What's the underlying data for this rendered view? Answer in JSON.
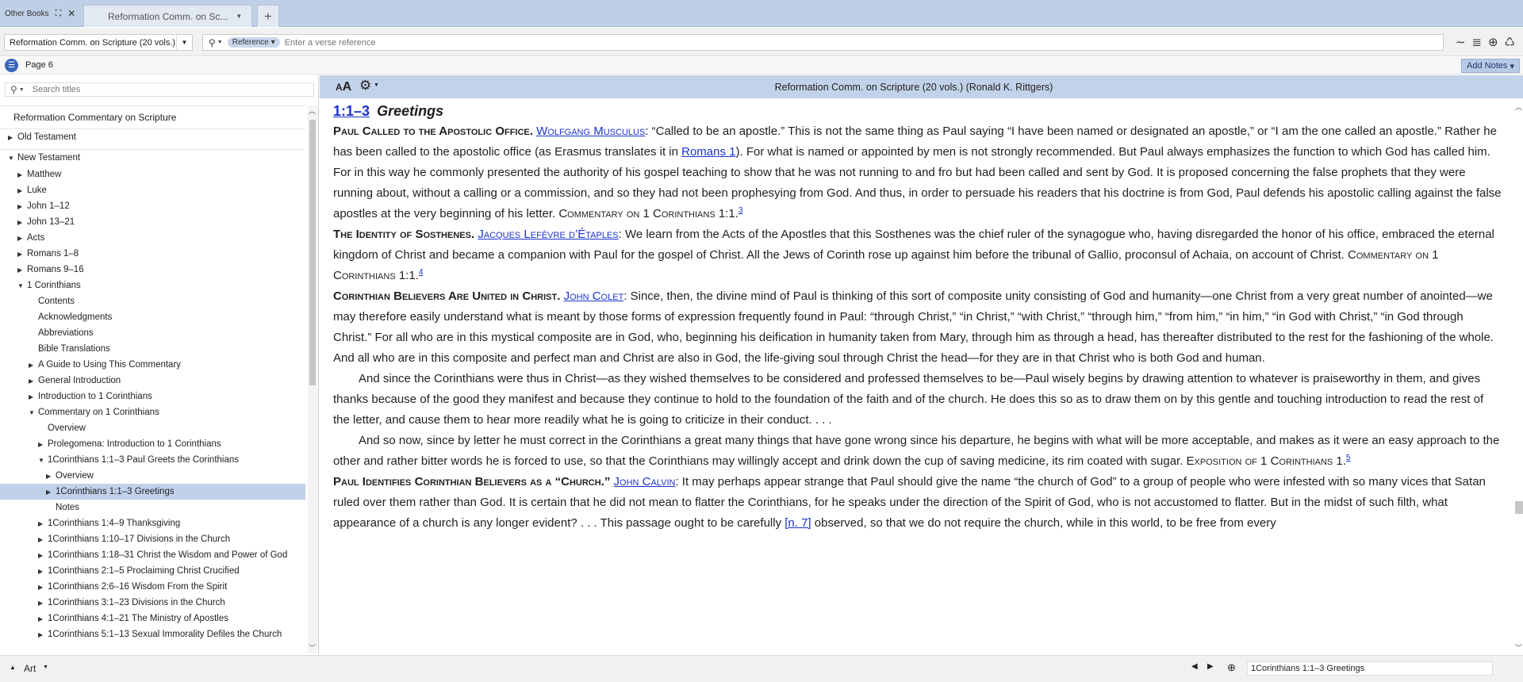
{
  "tabs": {
    "other_books": "Other Books",
    "active": "Reformation Comm. on Sc...",
    "add": "+"
  },
  "toolbar": {
    "resource": "Reformation Comm. on Scripture (20 vols.)",
    "ref_pill": "Reference",
    "ref_placeholder": "Enter a verse reference"
  },
  "pagebar": {
    "page": "Page 6",
    "add_notes": "Add Notes"
  },
  "sidebar": {
    "search_placeholder": "Search titles",
    "root": "Reformation Commentary on Scripture",
    "items": [
      {
        "label": "Old Testament",
        "arrow": "▶"
      },
      {
        "label": "New Testament",
        "arrow": "▼"
      },
      {
        "label": "Matthew",
        "arrow": "▶"
      },
      {
        "label": "Luke",
        "arrow": "▶"
      },
      {
        "label": "John 1–12",
        "arrow": "▶"
      },
      {
        "label": "John 13–21",
        "arrow": "▶"
      },
      {
        "label": "Acts",
        "arrow": "▶"
      },
      {
        "label": "Romans 1–8",
        "arrow": "▶"
      },
      {
        "label": "Romans 9–16",
        "arrow": "▶"
      },
      {
        "label": "1 Corinthians",
        "arrow": "▼"
      },
      {
        "label": "Contents",
        "arrow": ""
      },
      {
        "label": "Acknowledgments",
        "arrow": ""
      },
      {
        "label": "Abbreviations",
        "arrow": ""
      },
      {
        "label": "Bible Translations",
        "arrow": ""
      },
      {
        "label": "A Guide to Using This Commentary",
        "arrow": "▶"
      },
      {
        "label": "General Introduction",
        "arrow": "▶"
      },
      {
        "label": "Introduction to 1 Corinthians",
        "arrow": "▶"
      },
      {
        "label": "Commentary on 1 Corinthians",
        "arrow": "▼"
      },
      {
        "label": "Overview",
        "arrow": ""
      },
      {
        "label": "Prolegomena: Introduction to 1 Corinthians",
        "arrow": "▶"
      },
      {
        "label": "1Corinthians 1:1–3 Paul Greets the Corinthians",
        "arrow": "▼"
      },
      {
        "label": "Overview",
        "arrow": "▶"
      },
      {
        "label": "1Corinthians 1:1–3 Greetings",
        "arrow": "▶"
      },
      {
        "label": "Notes",
        "arrow": ""
      },
      {
        "label": "1Corinthians 1:4–9 Thanksgiving",
        "arrow": "▶"
      },
      {
        "label": "1Corinthians 1:10–17 Divisions in the Church",
        "arrow": "▶"
      },
      {
        "label": "1Corinthians 1:18–31 Christ the Wisdom and Power of God",
        "arrow": "▶"
      },
      {
        "label": "1Corinthians 2:1–5 Proclaiming Christ Crucified",
        "arrow": "▶"
      },
      {
        "label": "1Corinthians 2:6–16 Wisdom From the Spirit",
        "arrow": "▶"
      },
      {
        "label": "1Corinthians 3:1–23 Divisions in the Church",
        "arrow": "▶"
      },
      {
        "label": "1Corinthians 4:1–21 The Ministry of Apostles",
        "arrow": "▶"
      },
      {
        "label": "1Corinthians 5:1–13 Sexual Immorality Defiles the Church",
        "arrow": "▶"
      }
    ]
  },
  "content": {
    "resource_title": "Reformation Comm. on Scripture (20 vols.) (Ronald K. Rittgers)",
    "heading_ref": "1:1–3",
    "heading_title": "Greetings",
    "p1": {
      "head": "Paul Called to the Apostolic Office.",
      "author": "Wolfgang Musculus",
      "text_a": ": “Called to be an apostle.” This is not the same thing as Paul saying “I have been named or designated an apostle,” or “I am the one called an apostle.” Rather he has been called to the apostolic office (as Erasmus translates it in ",
      "link": "Romans 1",
      "text_b": "). For what is named or appointed by men is not strongly recommended. But Paul always emphasizes the function to which God has called him. For in this way he commonly presented the authority of his gospel teaching to show that he was not running to and fro but had been called and sent by God. It is proposed concerning the false prophets that they were running about, without a calling or a commission, and so they had not been prophesying from God. And thus, in order to persuade his readers that his doctrine is from God, Paul defends his apostolic calling against the false apostles at the very beginning of his letter. ",
      "source": "Commentary on 1 Corinthians 1:1.",
      "fn": "3"
    },
    "p2": {
      "head": "The Identity of Sosthenes.",
      "author": "Jacques Lefèvre d’Étaples",
      "text": ": We learn from the Acts of the Apostles that this Sosthenes was the chief ruler of the synagogue who, having disregarded the honor of his office, embraced the eternal kingdom of Christ and became a companion with Paul for the gospel of Christ. All the Jews of Corinth rose up against him before the tribunal of Gallio, proconsul of Achaia, on account of Christ. ",
      "source": "Commentary on 1 Corinthians 1:1.",
      "fn": "4"
    },
    "p3": {
      "head": "Corinthian Believers Are United in Christ.",
      "author": "John Colet",
      "text": ": Since, then, the divine mind of Paul is thinking of this sort of composite unity consisting of God and humanity—one Christ from a very great number of anointed—we may therefore easily understand what is meant by those forms of expression frequently found in Paul: “through Christ,” “in Christ,” “with Christ,” “through him,” “from him,” “in him,” “in God with Christ,” “in God through Christ.” For all who are in this mystical composite are in God, who, beginning his deification in humanity taken from Mary, through him as through a head, has thereafter distributed to the rest for the fashioning of the whole. And all who are in this composite and perfect man and Christ are also in God, the life-giving soul through Christ the head—for they are in that Christ who is both God and human.",
      "cont1": "And since the Corinthians were thus in Christ—as they wished themselves to be considered and professed themselves to be—Paul wisely begins by drawing attention to whatever is praiseworthy in them, and gives thanks because of the good they manifest and because they continue to hold to the foundation of the faith and of the church. He does this so as to draw them on by this gentle and touching introduction to read the rest of the letter, and cause them to hear more readily what he is going to criticize in their conduct. . . .",
      "cont2": "And so now, since by letter he must correct in the Corinthians a great many things that have gone wrong since his departure, he begins with what will be more acceptable, and makes as it were an easy approach to the other and rather bitter words he is forced to use, so that the Corinthians may willingly accept and drink down the cup of saving medicine, its rim coated with sugar. ",
      "source": "Exposition of 1 Corinthians 1.",
      "fn": "5"
    },
    "p4": {
      "head": "Paul Identifies Corinthian Believers as a “Church.”",
      "author": "John Calvin",
      "text_a": ": It may perhaps appear strange that Paul should give the name “the church of God” to a group of people who were infested with so many vices that Satan ruled over them rather than God. It is certain that he did not mean to flatter the Corinthians, for he speaks under the direction of the Spirit of God, who is not accustomed to flatter. But in the midst of such filth, what appearance of a church is any longer evident? . . . This passage ought to be carefully ",
      "fnref": "[n. 7]",
      "text_b": " observed, so that we do not require the church, while in this world, to be free from every"
    }
  },
  "bottombar": {
    "art": "Art",
    "location": "1Corinthians 1:1–3 Greetings"
  }
}
